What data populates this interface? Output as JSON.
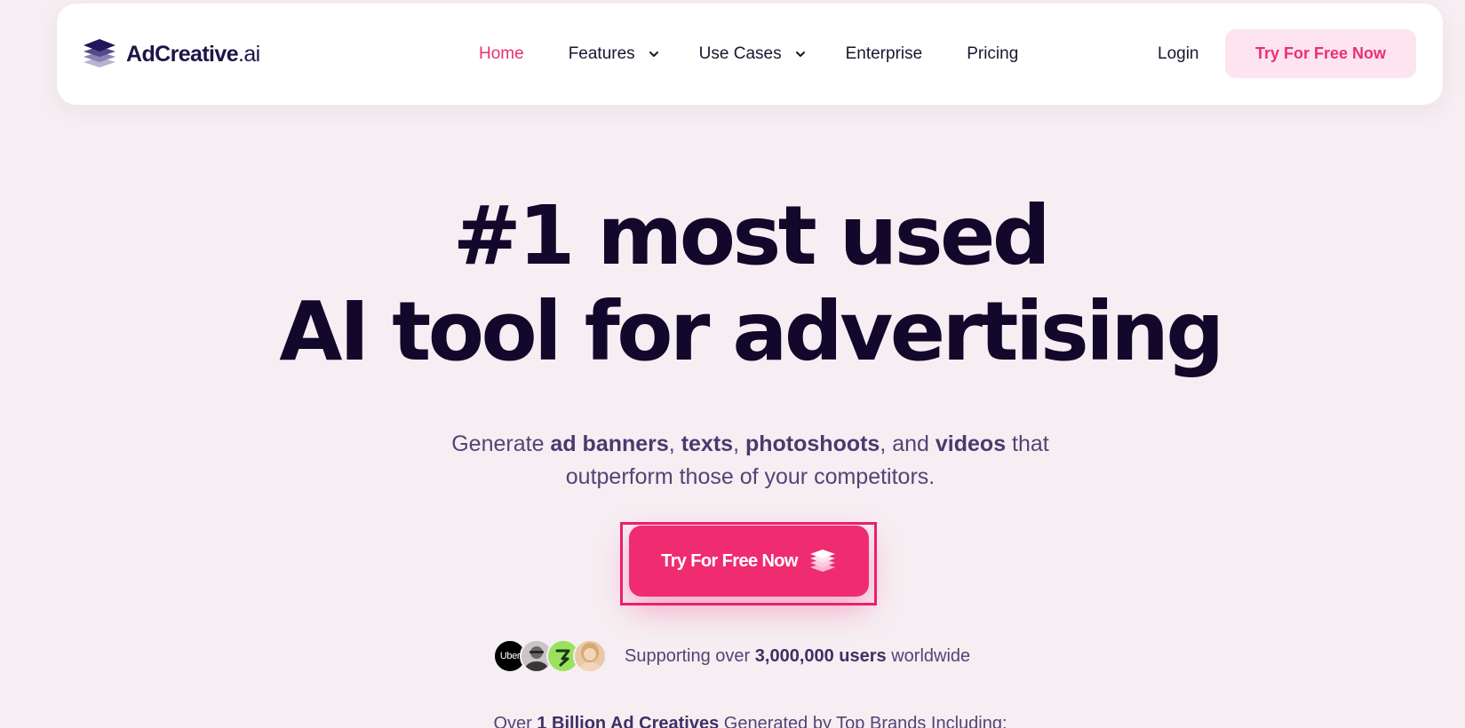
{
  "nav": {
    "logo": {
      "name": "AdCreative",
      "suffix": ".ai"
    },
    "links": [
      {
        "label": "Home",
        "active": true
      },
      {
        "label": "Features",
        "dropdown": true
      },
      {
        "label": "Use Cases",
        "dropdown": true
      },
      {
        "label": "Enterprise"
      },
      {
        "label": "Pricing"
      }
    ],
    "login": "Login",
    "cta": "Try For Free Now"
  },
  "hero": {
    "title_line1": "#1 most used",
    "title_line2": "AI tool for advertising",
    "subtitle": {
      "p1": "Generate ",
      "b1": "ad banners",
      "p2": ", ",
      "b2": "texts",
      "p3": ", ",
      "b3": "photoshoots",
      "p4": ", and ",
      "b4": "videos",
      "p5": " that",
      "line2": "outperform those of your competitors."
    },
    "cta": "Try For Free Now",
    "support": {
      "avatar_uber": "Uber",
      "prefix": "Supporting over ",
      "bold": "3,000,000 users",
      "suffix": " worldwide"
    },
    "brands": {
      "prefix": "Over ",
      "bold": "1 Billion Ad Creatives",
      "suffix": " Generated by Top Brands Including:"
    }
  },
  "colors": {
    "accent": "#ec2f73",
    "background": "#f6eef2",
    "heading": "#12082b",
    "body_text": "#524476",
    "cta_soft_bg": "#fde4ee"
  }
}
